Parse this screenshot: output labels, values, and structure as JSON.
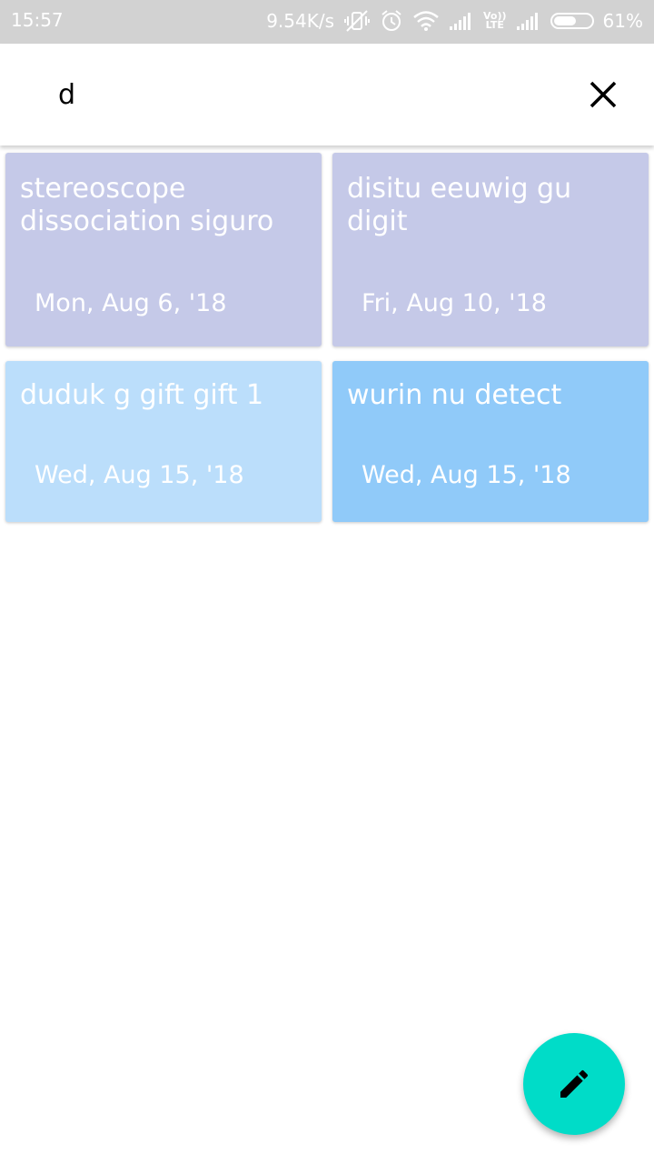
{
  "status_bar": {
    "time": "15:57",
    "network_speed": "9.54K/s",
    "lte_label_top": "Vo))",
    "lte_label_bottom": "LTE",
    "battery": "61%",
    "battery_level": 0.61,
    "icons": [
      "vibrate-off-icon",
      "alarm-icon",
      "wifi-icon",
      "signal-icon",
      "volte-icon",
      "signal-icon",
      "battery-icon"
    ]
  },
  "search": {
    "value": "d",
    "close_icon": "close-icon"
  },
  "notes": [
    {
      "title": "stereoscope dissociation siguro",
      "date": "Mon, Aug 6, '18",
      "color": "#c5c9e8"
    },
    {
      "title": "disitu eeuwig gu digit",
      "date": "Fri, Aug 10, '18",
      "color": "#c5c9e8"
    },
    {
      "title": "duduk g gift gift 1",
      "date": "Wed, Aug 15, '18",
      "color": "#bbdefb"
    },
    {
      "title": "wurin nu detect",
      "date": "Wed, Aug 15, '18",
      "color": "#90caf9"
    }
  ],
  "fab": {
    "icon": "pencil-icon",
    "color": "#00dcc8"
  }
}
